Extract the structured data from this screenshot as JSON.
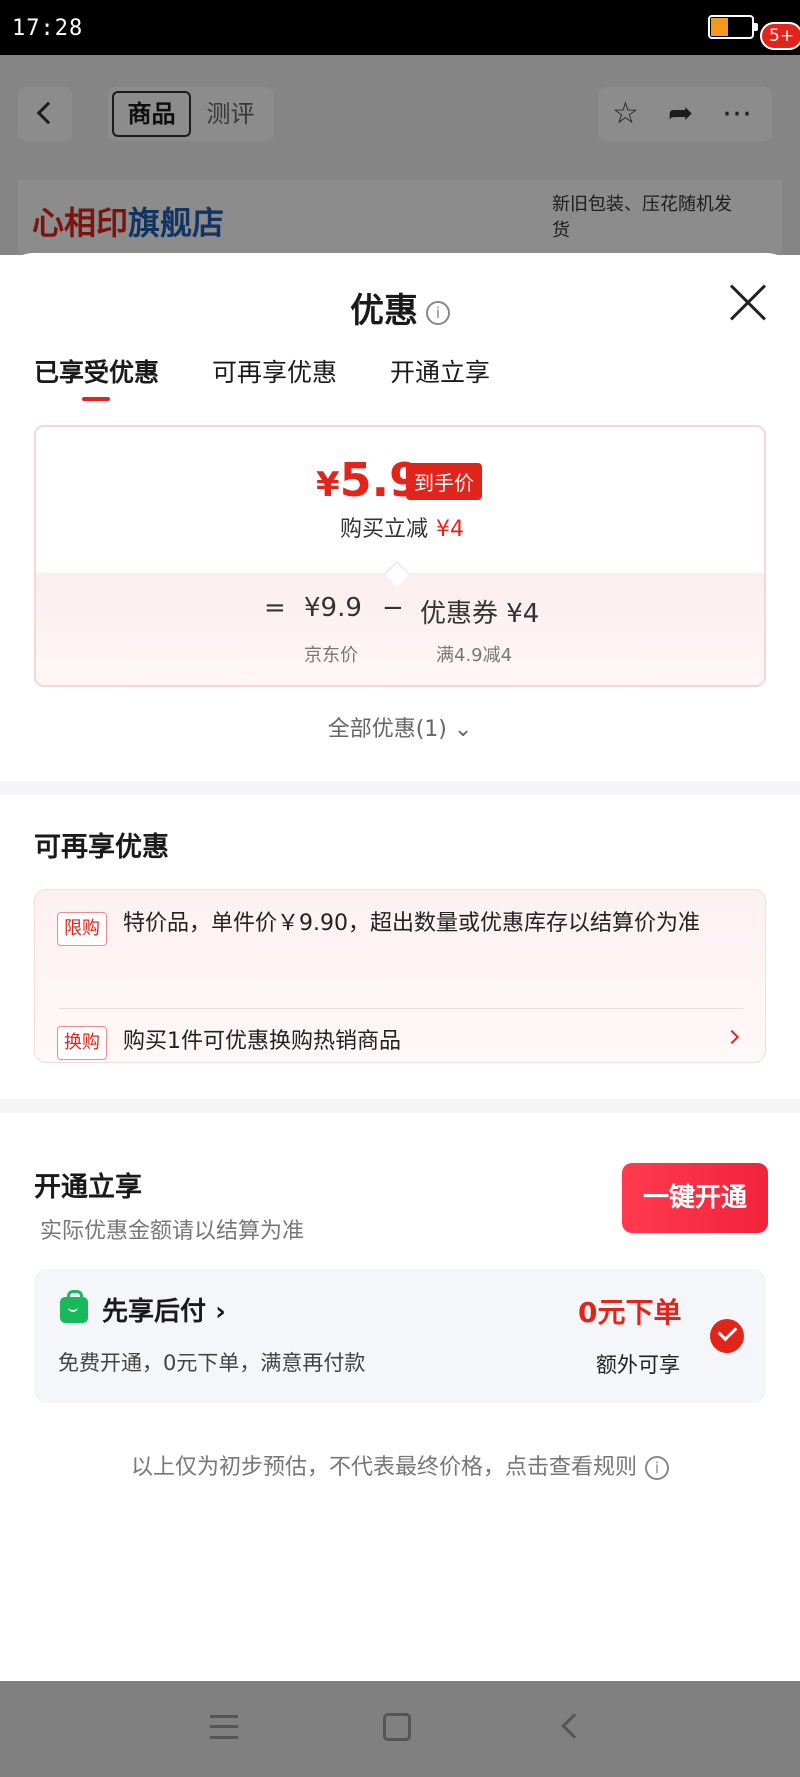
{
  "status_bar": {
    "time": "17:28"
  },
  "product_header": {
    "tabs": [
      "商品",
      "测评"
    ],
    "badge": "5+",
    "actions": {
      "favorite_icon": "star-icon",
      "share_icon": "share-icon",
      "more_icon": "more-icon"
    }
  },
  "shop": {
    "logo_text": "心相印",
    "name": "旗舰店",
    "banner_text": "新旧包装、压花随机发货"
  },
  "sheet": {
    "title": "优惠",
    "tabs": [
      "已享受优惠",
      "可再享优惠",
      "开通立享"
    ],
    "active_tab": "已享受优惠"
  },
  "price_card": {
    "currency": "¥",
    "final_price": "5.9",
    "final_label": "到手价",
    "reduce_label": "购买立减",
    "reduce_amount": "¥4",
    "equals": "=",
    "jd_price": "¥9.9",
    "minus": "−",
    "coupon": "优惠券 ¥4",
    "jd_price_label": "京东价",
    "coupon_rule": "满4.9减4"
  },
  "all_promotions": "全部优惠(1)",
  "more_promotions": {
    "title": "可再享优惠",
    "items": [
      {
        "tag": "限购",
        "text": "特价品，单件价￥9.90，超出数量或优惠库存以结算价为准"
      },
      {
        "tag": "换购",
        "text": "购买1件可优惠换购热销商品"
      }
    ]
  },
  "open_section": {
    "title": "开通立享",
    "note": "实际优惠金额请以结算为准",
    "button": "一键开通",
    "pay_later": {
      "title": "先享后付",
      "arrow": "›",
      "desc": "免费开通，0元下单，满意再付款",
      "highlight": "0元下单",
      "extra": "额外可享"
    }
  },
  "disclaimer": "以上仅为初步预估，不代表最终价格，点击查看规则",
  "colors": {
    "accent": "#e1251b",
    "pay_icon": "#18b95b"
  }
}
